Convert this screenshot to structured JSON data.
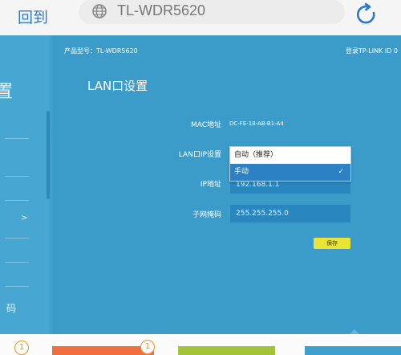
{
  "browser": {
    "back_label": "回到",
    "url": "TL-WDR5620",
    "icons": {
      "globe": "globe-icon",
      "refresh": "refresh-icon"
    }
  },
  "sidebar": {
    "big_char": "置",
    "arrow": ">",
    "bottom_char": "码"
  },
  "header": {
    "model": "产品型号：TL-WDR5620",
    "login": "登录TP-LINK ID  0"
  },
  "page": {
    "title": "LAN口设置"
  },
  "form": {
    "mac_label": "MAC地址",
    "mac_value": "DC-FE-18-AB-B1-A4",
    "lanip_label": "LAN口IP设置",
    "options": [
      "自动（推荐）",
      "手动"
    ],
    "selected_option": "手动",
    "ip_label": "IP地址",
    "ip_value": "192.168.1.1",
    "mask_label": "子网掩码",
    "mask_value": "255.255.255.0",
    "save_label": "保存"
  },
  "bottom": {
    "badge1": "1",
    "badge2": "1",
    "tile_colors": [
      "#f06f40",
      "#a3c33a",
      "#3fa0cd"
    ]
  },
  "colors": {
    "accent": "#3b9cca",
    "field": "#2a86bf",
    "selected": "#2c80c4",
    "save": "#e8e536",
    "badge": "#e8962a"
  }
}
